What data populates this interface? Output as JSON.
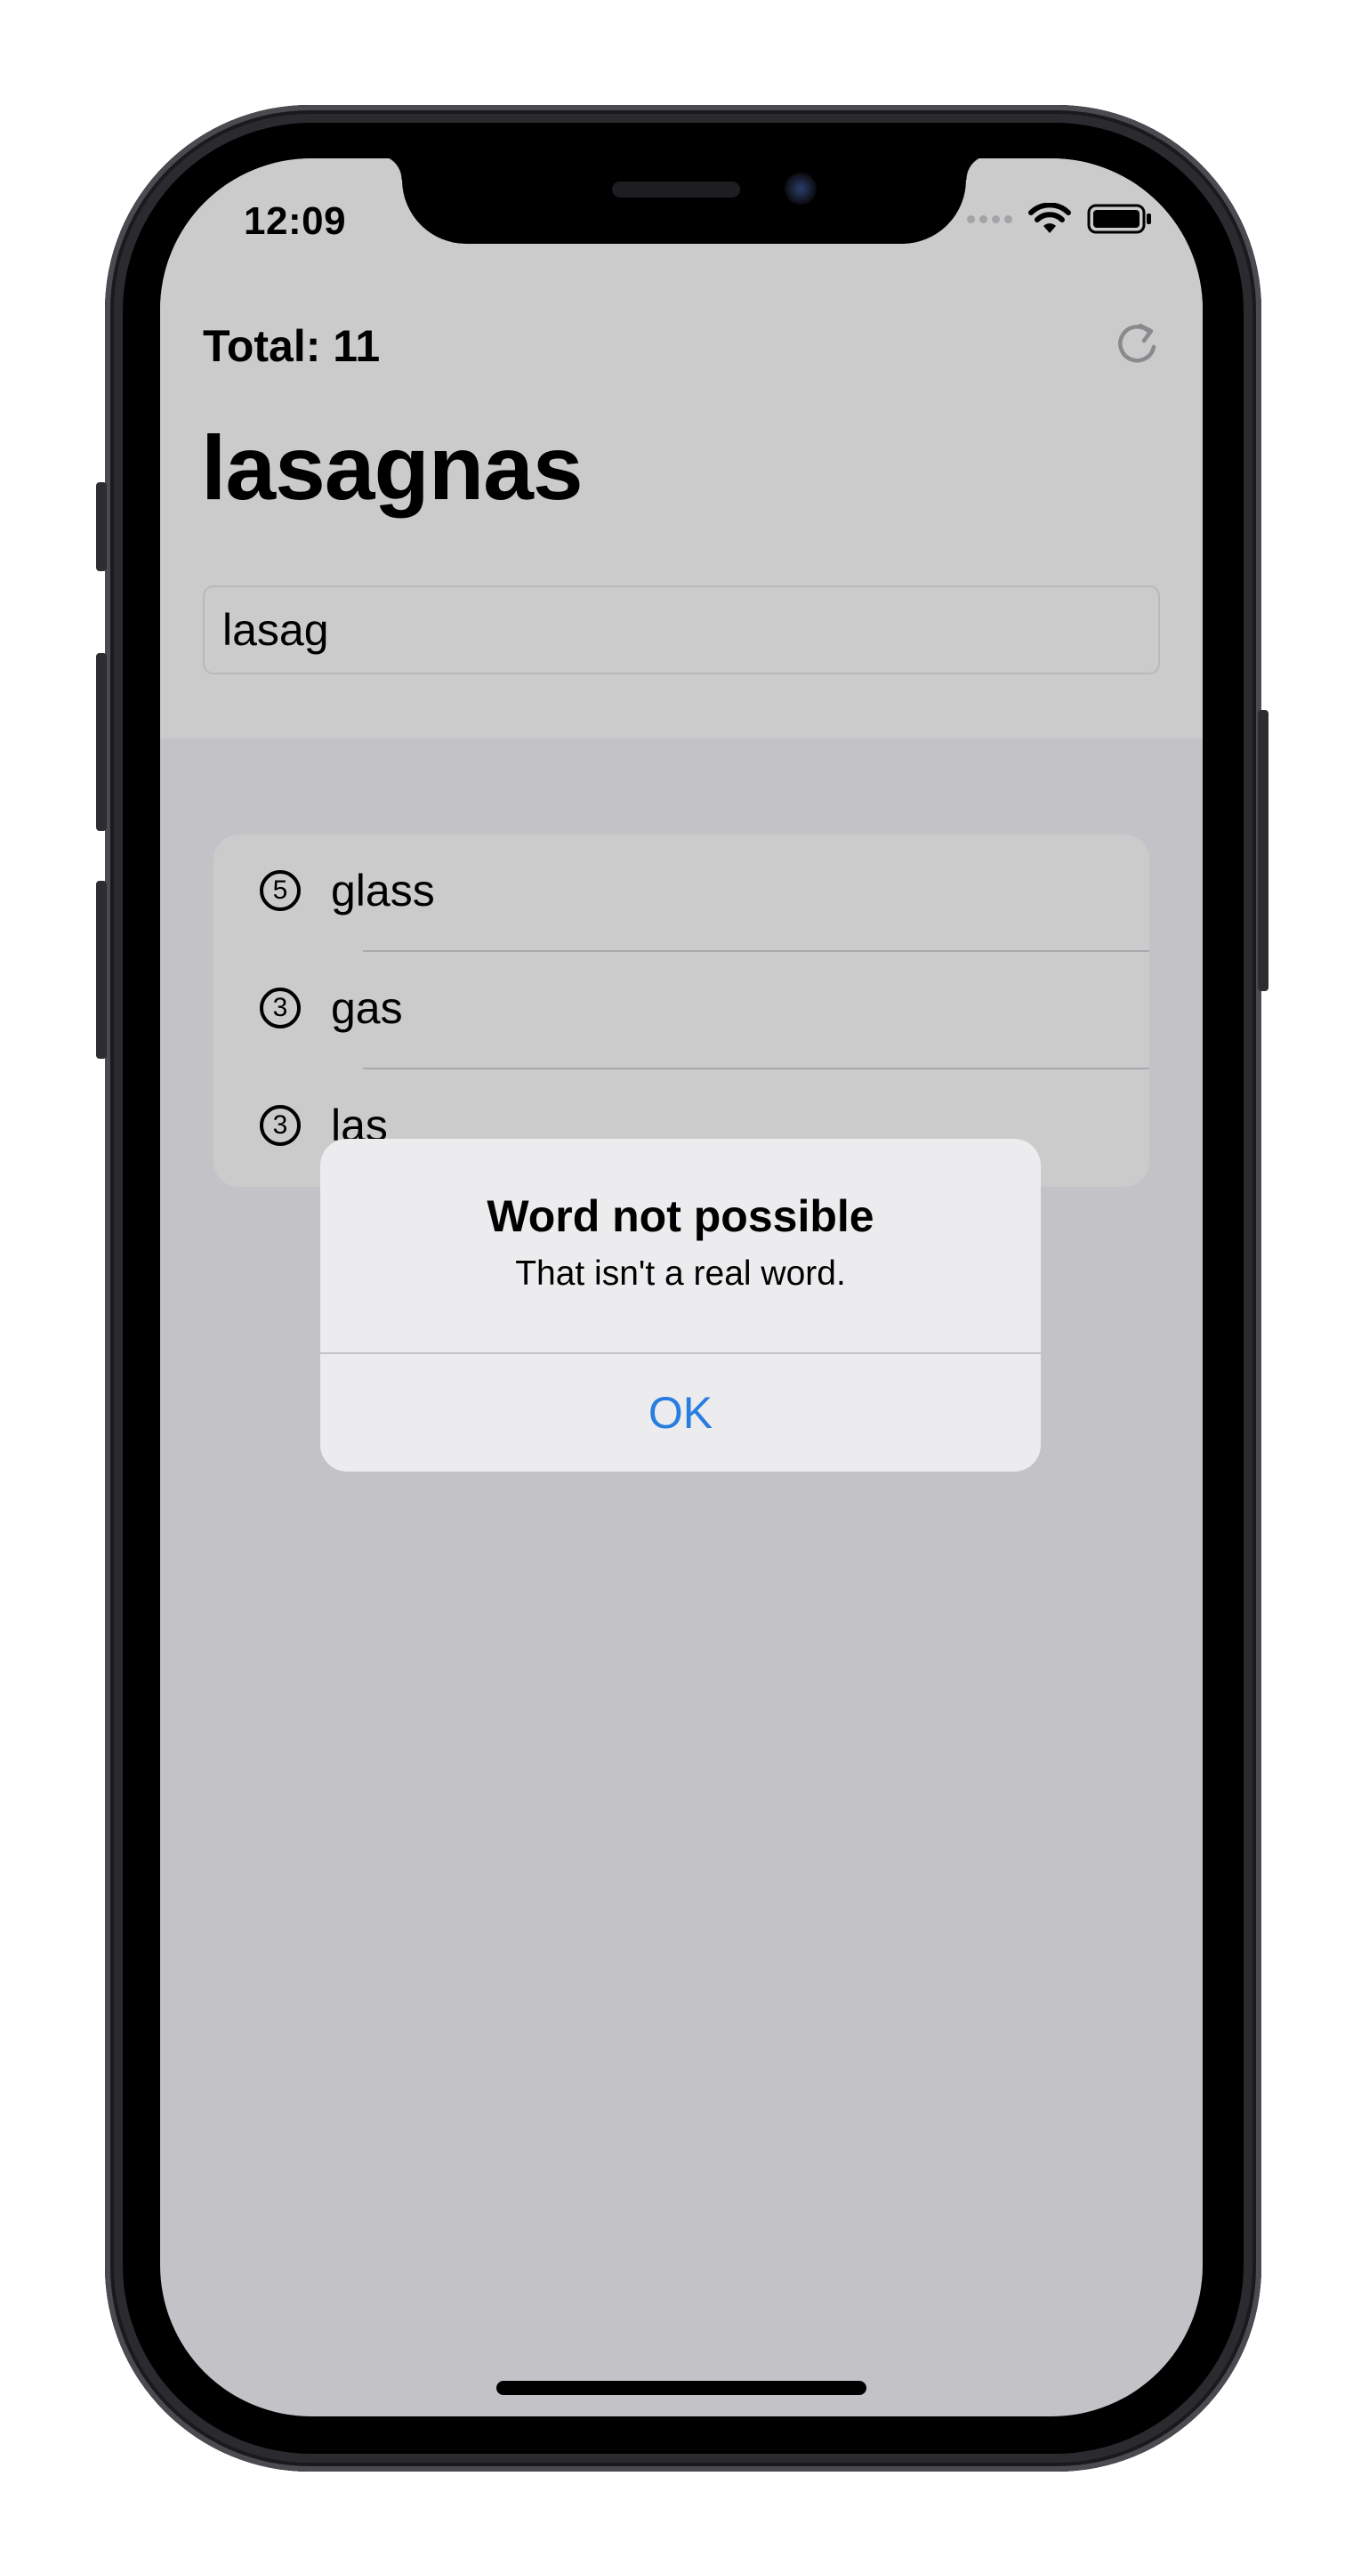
{
  "status_bar": {
    "time": "12:09",
    "icons": [
      "cellular-signal-icon",
      "wifi-icon",
      "battery-icon"
    ]
  },
  "header": {
    "total_label": "Total: 11",
    "refresh_icon": "refresh-icon"
  },
  "root_word": "lasagnas",
  "input": {
    "value": "lasag"
  },
  "used_words": [
    {
      "length": "5",
      "word": "glass"
    },
    {
      "length": "3",
      "word": "gas"
    },
    {
      "length": "3",
      "word": "las"
    }
  ],
  "alert": {
    "title": "Word not possible",
    "message": "That isn't a real word.",
    "ok_label": "OK"
  },
  "colors": {
    "accent": "#2a7de0",
    "dimmed_background": "#c2c2c7",
    "header_background": "#cbcbcb",
    "alert_background": "#ececee"
  }
}
